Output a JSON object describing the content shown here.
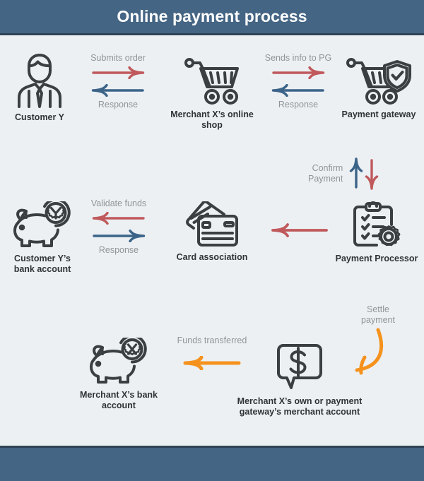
{
  "header": {
    "title": "Online payment process",
    "bar_color": "#446584",
    "border_color": "#2e4357",
    "text_color": "#ffffff"
  },
  "footer": {
    "bar_color": "#446584",
    "border_color": "#2e4357"
  },
  "canvas": {
    "background": "#ecf0f3"
  },
  "palette": {
    "red_arrow": "#c0595c",
    "blue_arrow": "#3c6489",
    "orange_arrow": "#f5921e",
    "icon_stroke": "#3a3f41",
    "node_label": "#2f3335",
    "connector_label": "#909598"
  },
  "nodes": [
    {
      "id": "customer-y",
      "label": "Customer Y",
      "icon": "businessman-icon"
    },
    {
      "id": "merchant-shop",
      "label": "Merchant X’s online shop",
      "icon": "shopping-cart-icon"
    },
    {
      "id": "payment-gateway",
      "label": "Payment gateway",
      "icon": "cart-shield-check-icon"
    },
    {
      "id": "customer-bank",
      "label": "Customer Y’s bank account",
      "icon": "piggy-bank-y-icon"
    },
    {
      "id": "card-association",
      "label": "Card association",
      "icon": "credit-cards-icon"
    },
    {
      "id": "payment-processor",
      "label": "Payment Processor",
      "icon": "clipboard-gear-icon"
    },
    {
      "id": "merchant-bank",
      "label": "Merchant X’s bank account",
      "icon": "piggy-bank-x-icon"
    },
    {
      "id": "merchant-account",
      "label": "Merchant X’s own or payment gateway’s merchant account",
      "icon": "dollar-speech-bubble-icon"
    }
  ],
  "connectors": [
    {
      "id": "customer-to-shop",
      "top_label": "Submits order",
      "bottom_label": "Response",
      "top_arrow": {
        "direction": "right",
        "color": "#c0595c"
      },
      "bottom_arrow": {
        "direction": "left",
        "color": "#3c6489"
      }
    },
    {
      "id": "shop-to-gateway",
      "top_label": "Sends info to PG",
      "bottom_label": "Response",
      "top_arrow": {
        "direction": "right",
        "color": "#c0595c"
      },
      "bottom_arrow": {
        "direction": "left",
        "color": "#3c6489"
      }
    },
    {
      "id": "gateway-confirm",
      "label": "Confirm Payment",
      "arrows": [
        {
          "direction": "up",
          "color": "#3c6489"
        },
        {
          "direction": "down",
          "color": "#c0595c"
        }
      ]
    },
    {
      "id": "bank-to-card-association",
      "top_label": "Validate funds",
      "bottom_label": "Response",
      "top_arrow": {
        "direction": "left",
        "color": "#c0595c"
      },
      "bottom_arrow": {
        "direction": "right",
        "color": "#3c6489"
      }
    },
    {
      "id": "processor-to-card-association",
      "label": "",
      "arrow": {
        "direction": "left",
        "color": "#c0595c"
      }
    },
    {
      "id": "funds-transferred",
      "label": "Funds transferred",
      "arrow": {
        "direction": "left",
        "color": "#f5921e"
      }
    },
    {
      "id": "settle-payment",
      "label": "Settle payment",
      "arrow": {
        "direction": "curved-down-left",
        "color": "#f5921e"
      }
    }
  ]
}
